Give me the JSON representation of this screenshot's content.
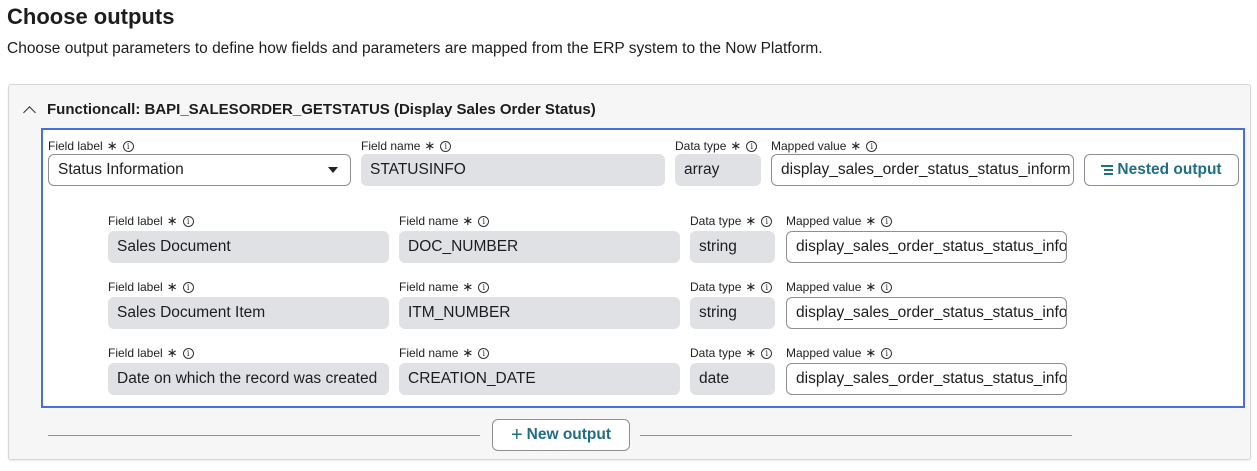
{
  "page": {
    "title": "Choose outputs",
    "description": "Choose output parameters to define how fields and parameters are mapped from the ERP system to the Now Platform."
  },
  "section": {
    "title": "Functioncall: BAPI_SALESORDER_GETSTATUS (Display Sales Order Status)",
    "expanded": true
  },
  "labels": {
    "field_label": "Field label",
    "field_name": "Field name",
    "data_type": "Data type",
    "mapped_value": "Mapped value",
    "required_mark": "∗",
    "info_mark": "i"
  },
  "parent_row": {
    "field_label": "Status Information",
    "field_name": "STATUSINFO",
    "data_type": "array",
    "mapped_value": "display_sales_order_status_status_inform"
  },
  "nested_rows": [
    {
      "field_label": "Sales Document",
      "field_name": "DOC_NUMBER",
      "data_type": "string",
      "mapped_value": "display_sales_order_status_status_info"
    },
    {
      "field_label": "Sales Document Item",
      "field_name": "ITM_NUMBER",
      "data_type": "string",
      "mapped_value": "display_sales_order_status_status_info"
    },
    {
      "field_label": "Date on which the record was created",
      "field_name": "CREATION_DATE",
      "data_type": "date",
      "mapped_value": "display_sales_order_status_status_info"
    }
  ],
  "buttons": {
    "nested_output": "Nested output",
    "new_output_plus": "+",
    "new_output": "New output"
  },
  "colors": {
    "accent": "#1f6e84",
    "selection_border": "#4a6ee0",
    "readonly_field": "#dfe1e4"
  }
}
